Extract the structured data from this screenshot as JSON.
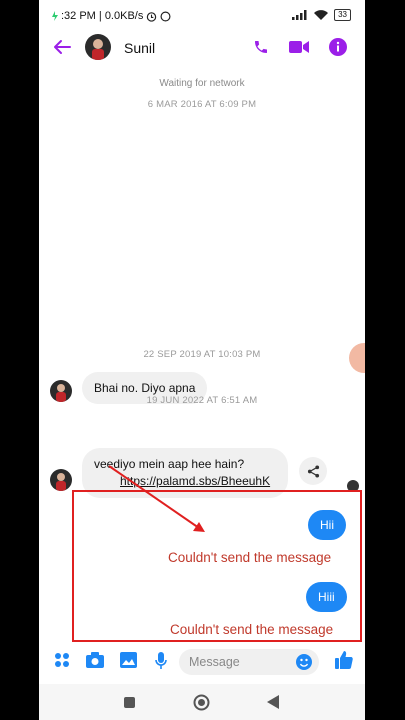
{
  "status": {
    "time_text": ":32 PM | 0.0KB/s",
    "battery": "33"
  },
  "header": {
    "contact_name": "Sunil"
  },
  "notice": {
    "waiting": "Waiting for network"
  },
  "timestamps": {
    "t1": "6 MAR 2016 AT 6:09 PM",
    "t2": "22 SEP 2019 AT 10:03 PM",
    "t3": "19 JUN 2022 AT 6:51 AM"
  },
  "messages": {
    "in1": "Bhai no. Diyo apna",
    "in2_text": "veediyo mein aap hee hain?",
    "in2_link": "https://palamd.sbs/BheeuhK",
    "out1": "Hii",
    "out2": "Hiii"
  },
  "errors": {
    "e1": "Couldn't send the message",
    "e2": "Couldn't send the message"
  },
  "composer": {
    "placeholder": "Message"
  },
  "colors": {
    "accent": "#9b1fe8",
    "outgoing": "#1e88f5",
    "error": "#c0392b",
    "highlight": "#e02020"
  }
}
